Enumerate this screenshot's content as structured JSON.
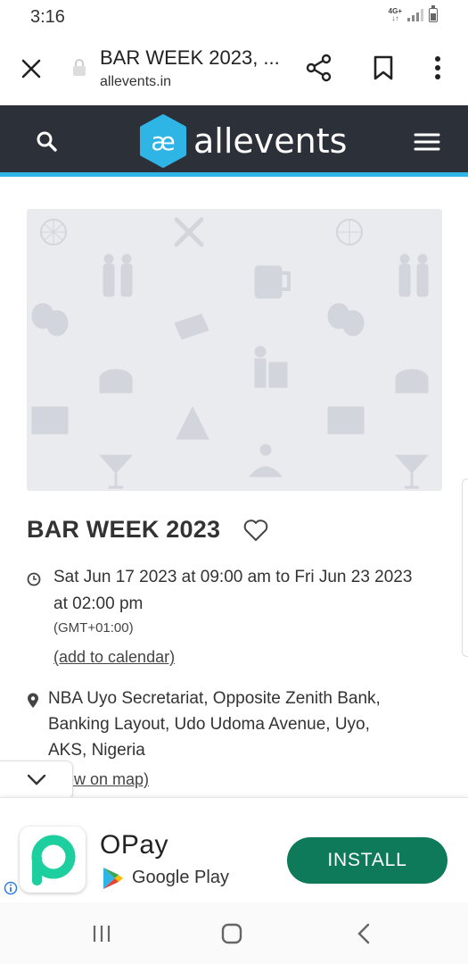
{
  "status_bar": {
    "time": "3:16",
    "network": "4G+"
  },
  "browser": {
    "title": "BAR WEEK 2023, ...",
    "url": "allevents.in"
  },
  "site": {
    "logo_text": "allevents",
    "accent_color": "#2fb4e6",
    "header_color": "#2c3038"
  },
  "event": {
    "title": "BAR WEEK 2023",
    "date_time": "Sat Jun 17 2023 at 09:00 am to Fri Jun 23 2023 at 02:00 pm",
    "timezone": "(GMT+01:00)",
    "add_to_calendar": "(add to calendar)",
    "address": "NBA Uyo Secretariat, Opposite Zenith Bank, Banking Layout, Udo Udoma Avenue, Uyo, AKS, Nigeria",
    "view_on_map": "(view on map)"
  },
  "ad": {
    "app_name": "OPay",
    "store": "Google Play",
    "install_label": "INSTALL",
    "install_color": "#0f7a5a"
  }
}
